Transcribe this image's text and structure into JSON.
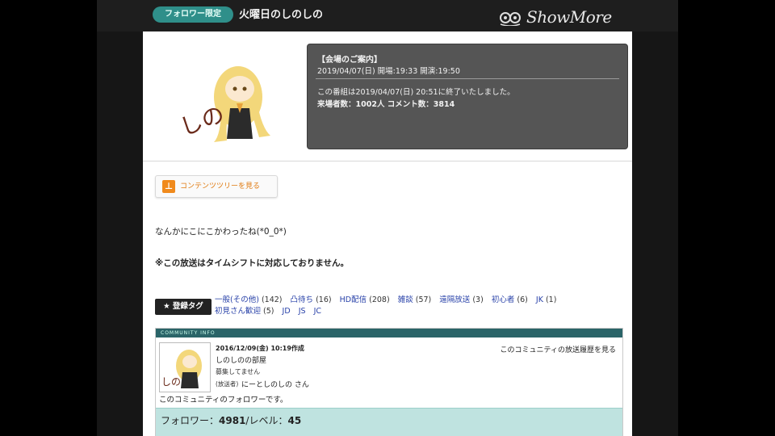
{
  "header": {
    "badge": "フォロワー限定",
    "title": "火曜日のしのしの",
    "logo_text": "ShowMore"
  },
  "broadcast_info": {
    "heading": "【会場のご案内】",
    "times": "2019/04/07(日) 開場:19:33 開演:19:50",
    "ended": "この番組は2019/04/07(日) 20:51に終了いたしました。",
    "stats": "来場者数：1002人 コメント数：3814"
  },
  "content_tree_button": "コンテンツツリーを見る",
  "description": "なんかにこにこかわったね(*0_0*)",
  "timeshift_notice": "※この放送はタイムシフトに対応しておりません。",
  "tags": {
    "label": "★ 登録タグ",
    "items": [
      {
        "name": "一般(その他)",
        "count": "(142)"
      },
      {
        "name": "凸待ち",
        "count": "(16)"
      },
      {
        "name": "HD配信",
        "count": "(208)"
      },
      {
        "name": "雑談",
        "count": "(57)"
      },
      {
        "name": "遠隔放送",
        "count": "(3)"
      },
      {
        "name": "初心者",
        "count": "(6)"
      },
      {
        "name": "JK",
        "count": "(1)"
      },
      {
        "name": "初見さん歓迎",
        "count": "(5)"
      },
      {
        "name": "JD",
        "count": ""
      },
      {
        "name": "JS",
        "count": ""
      },
      {
        "name": "JC",
        "count": ""
      }
    ]
  },
  "community": {
    "header": "COMMUNITY INFO",
    "date": "2016/12/09(金) 10:19作成",
    "name": "しのしのの部屋",
    "status": "募集してません",
    "owner_label": "(放送者)",
    "owner": "にーとしのしの さん",
    "history_link": "このコミュニティの放送履歴を見る",
    "follower_message": "このコミュニティのフォロワーです。",
    "followers_label": "フォロワー：",
    "followers": "4981",
    "level_label": "/レベル：",
    "level": "45"
  }
}
